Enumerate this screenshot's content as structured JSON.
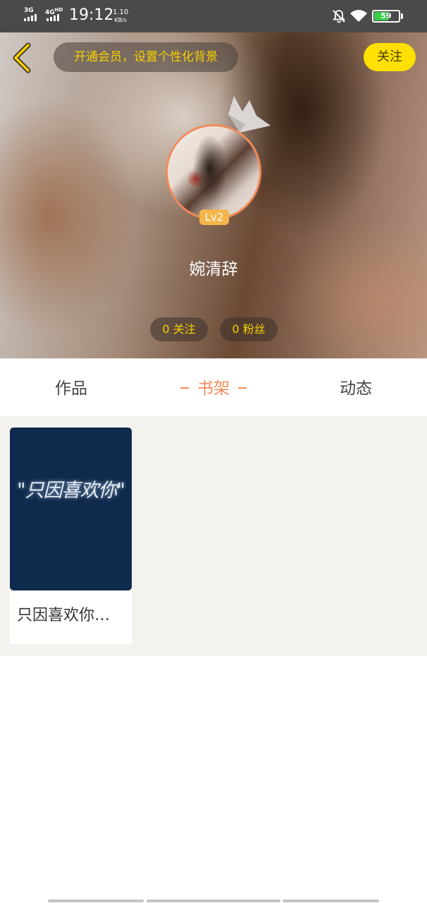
{
  "status_bar": {
    "net1": "3G",
    "net2": "4G",
    "net2_sup": "HD",
    "time": "19:12",
    "speed_value": "1.10",
    "speed_unit": "KB/s",
    "battery": "59",
    "battery_level": 0.59,
    "battery_color": "#3dcc4a"
  },
  "header": {
    "vip_banner": "开通会员，设置个性化背景",
    "follow_label": "关注",
    "level": "Lv2",
    "username": "婉清辞",
    "following": "0 关注",
    "fans": "0 粉丝"
  },
  "tabs": [
    {
      "label": "作品",
      "active": false
    },
    {
      "label": "书架",
      "active": true
    },
    {
      "label": "动态",
      "active": false
    }
  ],
  "shelf": {
    "books": [
      {
        "cover_text": "\"只因喜欢你\"",
        "title": "只因喜欢你…"
      }
    ]
  },
  "colors": {
    "accent": "#f08a5a",
    "follow_bg": "#ffe000",
    "banner_text": "#f5d000",
    "shelf_bg": "#f4f2ec"
  }
}
